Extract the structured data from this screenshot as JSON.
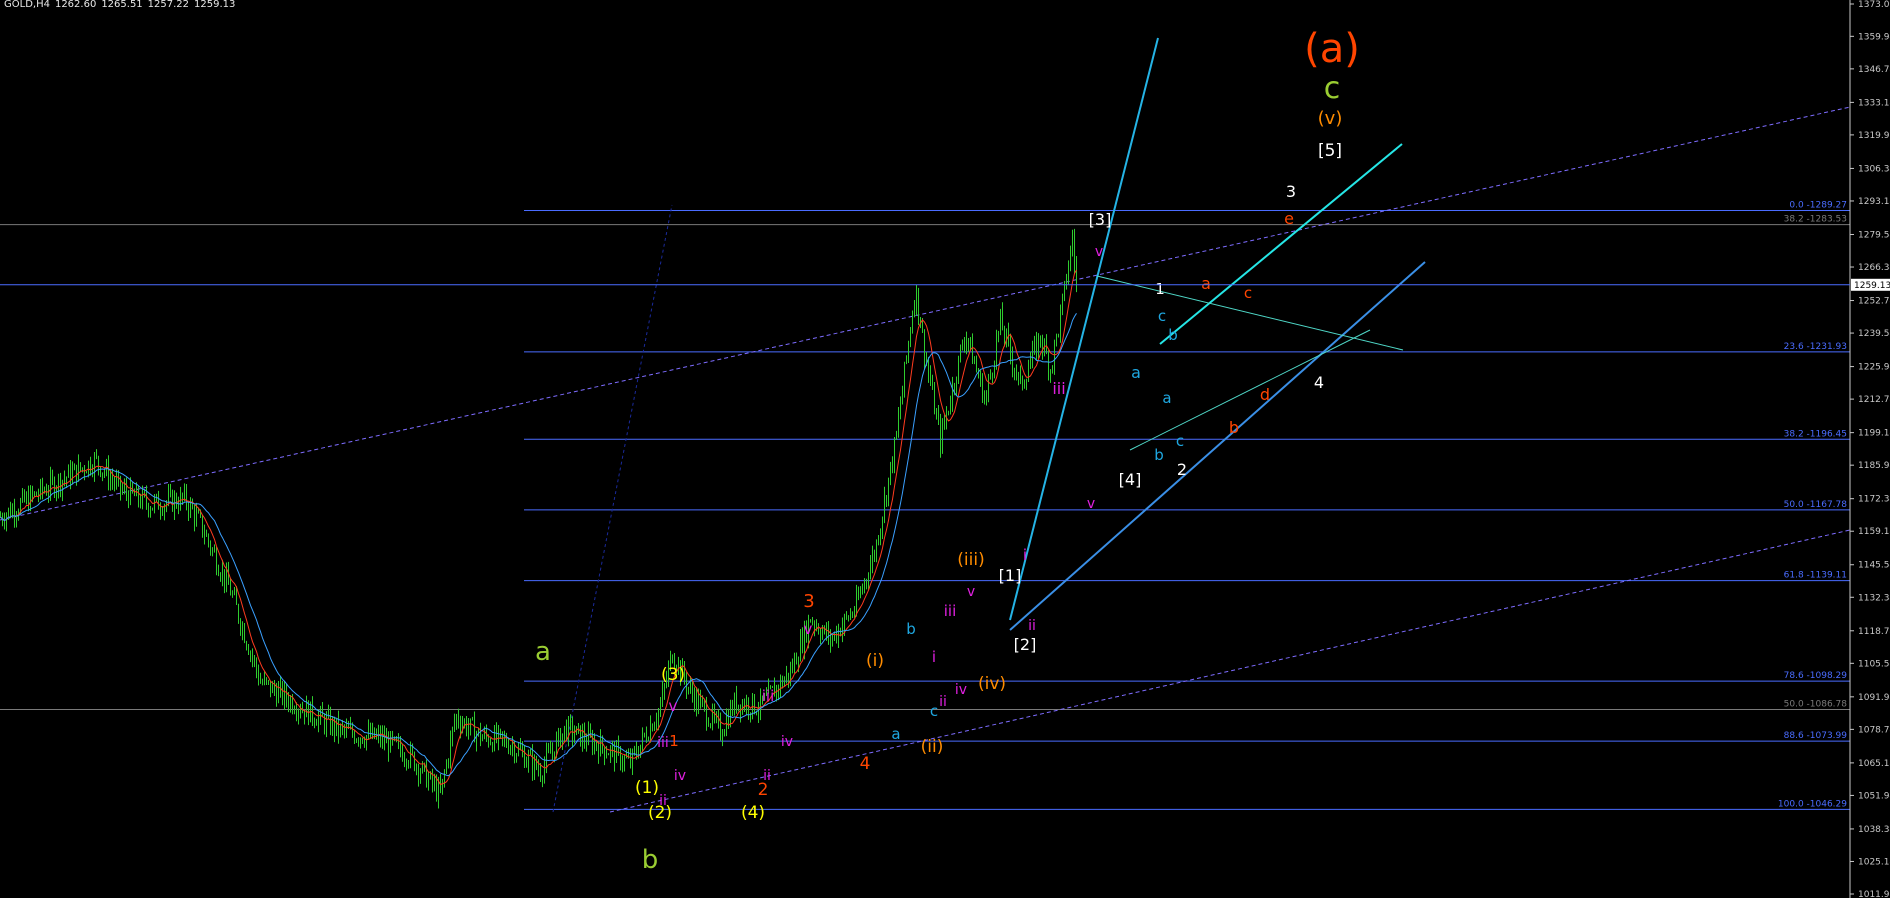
{
  "header": {
    "symbol": "GOLD,H4",
    "open": "1262.60",
    "high": "1265.51",
    "low": "1257.22",
    "close": "1259.13"
  },
  "chart_data": {
    "type": "candlestick",
    "instrument": "GOLD",
    "timeframe": "H4",
    "ylim": [
      1011.94,
      1373.0
    ],
    "price_axis_ticks": [
      "1373.06",
      "1359.94",
      "1346.74",
      "1333.14",
      "1319.95",
      "1306.34",
      "1293.14",
      "1279.54",
      "1266.34",
      "1252.74",
      "1239.54",
      "1225.94",
      "1212.74",
      "1199.14",
      "1185.94",
      "1172.34",
      "1159.14",
      "1145.54",
      "1132.34",
      "1118.74",
      "1105.54",
      "1091.94",
      "1078.74",
      "1065.14",
      "1051.94",
      "1038.34",
      "1025.14",
      "1011.94"
    ],
    "current_price": "1259.13",
    "fibonacci_levels": [
      {
        "label": "0.0 -1289.27",
        "color": "#4a6cff"
      },
      {
        "label": "38.2 -1283.53",
        "color": "#7a7a7a"
      },
      {
        "label": "23.6 -1231.93",
        "color": "#4a6cff"
      },
      {
        "label": "38.2 -1196.45",
        "color": "#4a6cff"
      },
      {
        "label": "50.0 -1167.78",
        "color": "#4a6cff"
      },
      {
        "label": "61.8 -1139.11",
        "color": "#4a6cff"
      },
      {
        "label": "78.6 -1098.29",
        "color": "#4a6cff"
      },
      {
        "label": "50.0 -1086.78",
        "color": "#7a7a7a"
      },
      {
        "label": "88.6 -1073.99",
        "color": "#4a6cff"
      },
      {
        "label": "100.0 -1046.29",
        "color": "#4a6cff"
      }
    ],
    "price_path": [
      {
        "x": 0,
        "p": 1165
      },
      {
        "x": 40,
        "p": 1175
      },
      {
        "x": 95,
        "p": 1188
      },
      {
        "x": 120,
        "p": 1176
      },
      {
        "x": 150,
        "p": 1170
      },
      {
        "x": 185,
        "p": 1172
      },
      {
        "x": 200,
        "p": 1162
      },
      {
        "x": 230,
        "p": 1135
      },
      {
        "x": 260,
        "p": 1098
      },
      {
        "x": 300,
        "p": 1088
      },
      {
        "x": 340,
        "p": 1078
      },
      {
        "x": 380,
        "p": 1075
      },
      {
        "x": 410,
        "p": 1068
      },
      {
        "x": 440,
        "p": 1052
      },
      {
        "x": 455,
        "p": 1084
      },
      {
        "x": 480,
        "p": 1076
      },
      {
        "x": 510,
        "p": 1073
      },
      {
        "x": 540,
        "p": 1062
      },
      {
        "x": 565,
        "p": 1079
      },
      {
        "x": 600,
        "p": 1072
      },
      {
        "x": 630,
        "p": 1065
      },
      {
        "x": 660,
        "p": 1088
      },
      {
        "x": 672,
        "p": 1110
      },
      {
        "x": 690,
        "p": 1094
      },
      {
        "x": 720,
        "p": 1078
      },
      {
        "x": 735,
        "p": 1090
      },
      {
        "x": 760,
        "p": 1088
      },
      {
        "x": 790,
        "p": 1102
      },
      {
        "x": 810,
        "p": 1124
      },
      {
        "x": 830,
        "p": 1115
      },
      {
        "x": 855,
        "p": 1128
      },
      {
        "x": 875,
        "p": 1152
      },
      {
        "x": 895,
        "p": 1195
      },
      {
        "x": 915,
        "p": 1258
      },
      {
        "x": 925,
        "p": 1230
      },
      {
        "x": 940,
        "p": 1196
      },
      {
        "x": 965,
        "p": 1240
      },
      {
        "x": 985,
        "p": 1212
      },
      {
        "x": 1000,
        "p": 1244
      },
      {
        "x": 1020,
        "p": 1218
      },
      {
        "x": 1040,
        "p": 1238
      },
      {
        "x": 1050,
        "p": 1225
      },
      {
        "x": 1060,
        "p": 1246
      },
      {
        "x": 1072,
        "p": 1278
      },
      {
        "x": 1076,
        "p": 1259
      }
    ],
    "wave_labels": [
      {
        "text": "(a)",
        "color": "#ff4500"
      },
      {
        "text": "c",
        "color": "#9acd32"
      },
      {
        "text": "(v)",
        "color": "#ff8c00"
      },
      {
        "text": "[5]",
        "color": "#ffffff"
      },
      {
        "text": "3",
        "color": "#ffffff"
      },
      {
        "text": "e",
        "color": "#ff4500"
      },
      {
        "text": "[3]",
        "color": "#ffffff"
      },
      {
        "text": "v",
        "color": "#e020e0"
      },
      {
        "text": "1",
        "color": "#ffffff"
      },
      {
        "text": "a",
        "color": "#ff4500"
      },
      {
        "text": "c",
        "color": "#ff4500"
      },
      {
        "text": "c",
        "color": "#1ea7e0"
      },
      {
        "text": "b",
        "color": "#1ea7e0"
      },
      {
        "text": "a",
        "color": "#1ea7e0"
      },
      {
        "text": "a",
        "color": "#1ea7e0"
      },
      {
        "text": "iii",
        "color": "#e020e0"
      },
      {
        "text": "c",
        "color": "#1ea7e0"
      },
      {
        "text": "b",
        "color": "#1ea7e0"
      },
      {
        "text": "2",
        "color": "#ffffff"
      },
      {
        "text": "d",
        "color": "#ff4500"
      },
      {
        "text": "b",
        "color": "#ff4500"
      },
      {
        "text": "4",
        "color": "#ffffff"
      },
      {
        "text": "[4]",
        "color": "#ffffff"
      },
      {
        "text": "v",
        "color": "#e020e0"
      },
      {
        "text": "(iii)",
        "color": "#ff8c00"
      },
      {
        "text": "i",
        "color": "#e020e0"
      },
      {
        "text": "[1]",
        "color": "#ffffff"
      },
      {
        "text": "v",
        "color": "#e020e0"
      },
      {
        "text": "iii",
        "color": "#e020e0"
      },
      {
        "text": "ii",
        "color": "#e020e0"
      },
      {
        "text": "[2]",
        "color": "#ffffff"
      },
      {
        "text": "3",
        "color": "#ff4500"
      },
      {
        "text": "v",
        "color": "#e020e0"
      },
      {
        "text": "b",
        "color": "#1ea7e0"
      },
      {
        "text": "(i)",
        "color": "#ff8c00"
      },
      {
        "text": "i",
        "color": "#e020e0"
      },
      {
        "text": "(iv)",
        "color": "#ff8c00"
      },
      {
        "text": "iv",
        "color": "#e020e0"
      },
      {
        "text": "ii",
        "color": "#e020e0"
      },
      {
        "text": "c",
        "color": "#1ea7e0"
      },
      {
        "text": "a",
        "color": "#1ea7e0"
      },
      {
        "text": "(ii)",
        "color": "#ff8c00"
      },
      {
        "text": "4",
        "color": "#ff4500"
      },
      {
        "text": "iii",
        "color": "#e020e0"
      },
      {
        "text": "iv",
        "color": "#e020e0"
      },
      {
        "text": "1",
        "color": "#ff4500"
      },
      {
        "text": "ii",
        "color": "#e020e0"
      },
      {
        "text": "2",
        "color": "#ff4500"
      },
      {
        "text": "a",
        "color": "#9acd32"
      },
      {
        "text": "(3)",
        "color": "#ffff00"
      },
      {
        "text": "v",
        "color": "#e020e0"
      },
      {
        "text": "iii",
        "color": "#e020e0"
      },
      {
        "text": "iv",
        "color": "#e020e0"
      },
      {
        "text": "(1)",
        "color": "#ffff00"
      },
      {
        "text": "ii",
        "color": "#e020e0"
      },
      {
        "text": "(2)",
        "color": "#ffff00"
      },
      {
        "text": "(4)",
        "color": "#ffff00"
      },
      {
        "text": "b",
        "color": "#9acd32"
      }
    ]
  }
}
